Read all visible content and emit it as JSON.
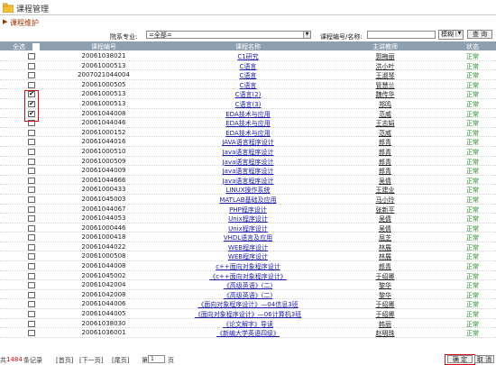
{
  "header": {
    "title": "课程管理",
    "subtitle": "课程维护"
  },
  "filter": {
    "major_label": "院系专业:",
    "major_value": "=全部=",
    "course_label": "课程编号/名称:",
    "mode_value": "模糊",
    "query_button": "查 询"
  },
  "table": {
    "columns": {
      "select_all": "全选",
      "no": "课程编号",
      "name": "课程名称",
      "teacher": "主讲教师",
      "status": "状态"
    },
    "rows": [
      {
        "no": "20061038021",
        "name": "C1研究",
        "teacher": "郭梅丽",
        "status": "正常",
        "checked": false
      },
      {
        "no": "20061000513",
        "name": "C语言",
        "teacher": "洪小叶",
        "status": "正常",
        "checked": false
      },
      {
        "no": "2007021044004",
        "name": "C语言",
        "teacher": "王淑琴",
        "status": "正常",
        "checked": false
      },
      {
        "no": "20061000505",
        "name": "C语言",
        "teacher": "管慧兰",
        "status": "正常",
        "checked": false
      },
      {
        "no": "20061000513",
        "name": "C语言(2)",
        "teacher": "魏传华",
        "status": "正常",
        "checked": true
      },
      {
        "no": "20061000513",
        "name": "C语言(3)",
        "teacher": "郑鸣",
        "status": "正常",
        "checked": true
      },
      {
        "no": "20061044008",
        "name": "EDA技术与应用",
        "teacher": "范威",
        "status": "正常",
        "checked": true
      },
      {
        "no": "20061044046",
        "name": "EDA技术与应用",
        "teacher": "王志娟",
        "status": "正常",
        "checked": false
      },
      {
        "no": "20061000152",
        "name": "EDA技术与应用",
        "teacher": "范威",
        "status": "正常",
        "checked": false
      },
      {
        "no": "20061044016",
        "name": "JAVA语言程序设计",
        "teacher": "郎青",
        "status": "正常",
        "checked": false
      },
      {
        "no": "20061000510",
        "name": "Java语言程序设计",
        "teacher": "郎青",
        "status": "正常",
        "checked": false
      },
      {
        "no": "20061000509",
        "name": "Java语言程序设计",
        "teacher": "郎青",
        "status": "正常",
        "checked": false
      },
      {
        "no": "20061044009",
        "name": "Java语言程序设计",
        "teacher": "郎青",
        "status": "正常",
        "checked": false
      },
      {
        "no": "20061044666",
        "name": "Java语言程序设计",
        "teacher": "吴倩",
        "status": "正常",
        "checked": false
      },
      {
        "no": "20061000433",
        "name": "LINUX操作系统",
        "teacher": "王建业",
        "status": "正常",
        "checked": false
      },
      {
        "no": "20061045003",
        "name": "MATLAB基础及应用",
        "teacher": "马小玲",
        "status": "正常",
        "checked": false
      },
      {
        "no": "20061044067",
        "name": "PHP程序设计",
        "teacher": "张新平",
        "status": "正常",
        "checked": false
      },
      {
        "no": "20061044053",
        "name": "Unix程序设计",
        "teacher": "吴倩",
        "status": "正常",
        "checked": false
      },
      {
        "no": "20061000446",
        "name": "Unix程序设计",
        "teacher": "吴倩",
        "status": "正常",
        "checked": false
      },
      {
        "no": "20061000418",
        "name": "VHDL语言及应用",
        "teacher": "屈芝",
        "status": "正常",
        "checked": false
      },
      {
        "no": "20061044022",
        "name": "WEB程序设计",
        "teacher": "林展",
        "status": "正常",
        "checked": false
      },
      {
        "no": "20061000508",
        "name": "WEB程序设计",
        "teacher": "林展",
        "status": "正常",
        "checked": false
      },
      {
        "no": "20061044008",
        "name": "c++面向对象程序设计",
        "teacher": "郎青",
        "status": "正常",
        "checked": false
      },
      {
        "no": "20061045002",
        "name": "《c++面向对象程序设计》",
        "teacher": "于绍卿",
        "status": "正常",
        "checked": false
      },
      {
        "no": "20061042004",
        "name": "《高级英语》(二)",
        "teacher": "黎华",
        "status": "正常",
        "checked": false
      },
      {
        "no": "20061042008",
        "name": "《高级英语》(二)",
        "teacher": "黎华",
        "status": "正常",
        "checked": false
      },
      {
        "no": "20061044006",
        "name": "《面向对象程序设计》—04信息3班",
        "teacher": "于绍卿",
        "status": "正常",
        "checked": false
      },
      {
        "no": "20061044005",
        "name": "《面向对象程序设计》—06计算机3班",
        "teacher": "于绍卿",
        "status": "正常",
        "checked": false
      },
      {
        "no": "20061038030",
        "name": "《论文解字》导读",
        "teacher": "韩丽",
        "status": "正常",
        "checked": false
      },
      {
        "no": "20061036001",
        "name": "《新编大学英语四级》",
        "teacher": "赵明珠",
        "status": "正常",
        "checked": false
      }
    ]
  },
  "footer": {
    "total_prefix": "共",
    "total_count": "1484",
    "total_suffix": "条记录",
    "first": "[首页]",
    "prev": "[下一页]",
    "next": "[尾页]",
    "page_prefix": "第",
    "page_value": "1",
    "page_suffix": "页",
    "ok": "确 定",
    "cancel": "取 消"
  }
}
